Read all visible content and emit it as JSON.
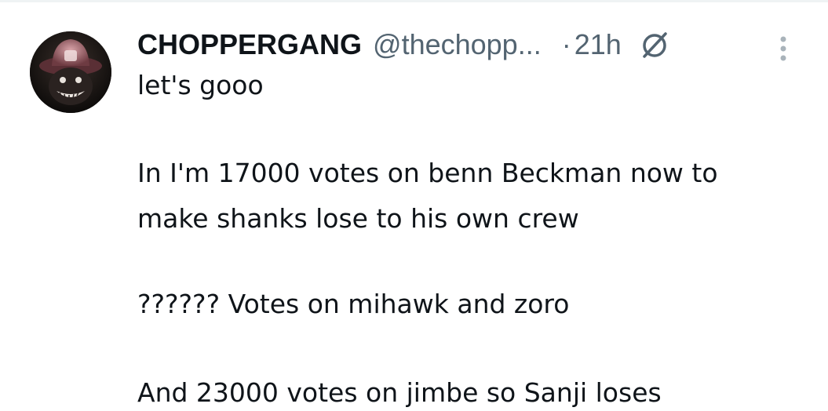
{
  "tweet": {
    "display_name": "CHOPPERGANG",
    "handle": "@thechopp...",
    "separator": "·",
    "timestamp": "21h",
    "icons": {
      "avatar": "profile-avatar",
      "grok": "grok-icon",
      "more": "more-options-icon"
    },
    "body_lines": [
      "let's gooo",
      "In I'm 17000 votes on benn Beckman now to",
      "make shanks lose to his own crew",
      "?????? Votes on mihawk and zoro",
      "And 23000 votes on jimbe so Sanji loses"
    ]
  },
  "colors": {
    "primary_text": "#0f1419",
    "secondary_text": "#536471",
    "background": "#ffffff",
    "divider": "#eff3f4"
  }
}
